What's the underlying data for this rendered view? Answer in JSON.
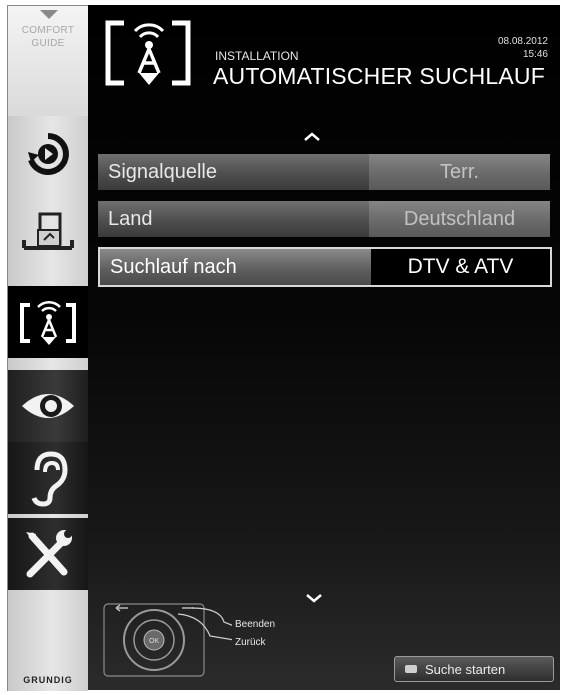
{
  "sidebar": {
    "comfort_line1": "COMFORT",
    "comfort_line2": "GUIDE",
    "brand": "GRUNDIG",
    "icons": [
      "source-icon",
      "media-icon",
      "installation-icon",
      "picture-icon",
      "sound-icon",
      "tools-icon"
    ]
  },
  "header": {
    "subtitle": "INSTALLATION",
    "title": "AUTOMATISCHER SUCHLAUF",
    "date": "08.08.2012",
    "time": "15:46"
  },
  "menu": {
    "rows": [
      {
        "label": "Signalquelle",
        "value": "Terr."
      },
      {
        "label": "Land",
        "value": "Deutschland"
      },
      {
        "label": "Suchlauf nach",
        "value": "DTV & ATV"
      }
    ]
  },
  "footer": {
    "exit_label": "Beenden",
    "back_label": "Zurück",
    "ok_label": "OK",
    "start_label": "Suche starten"
  },
  "colors": {
    "background": "#000000",
    "row_grey": "#5a5a5a",
    "sidebar": "#dcdcdc"
  }
}
